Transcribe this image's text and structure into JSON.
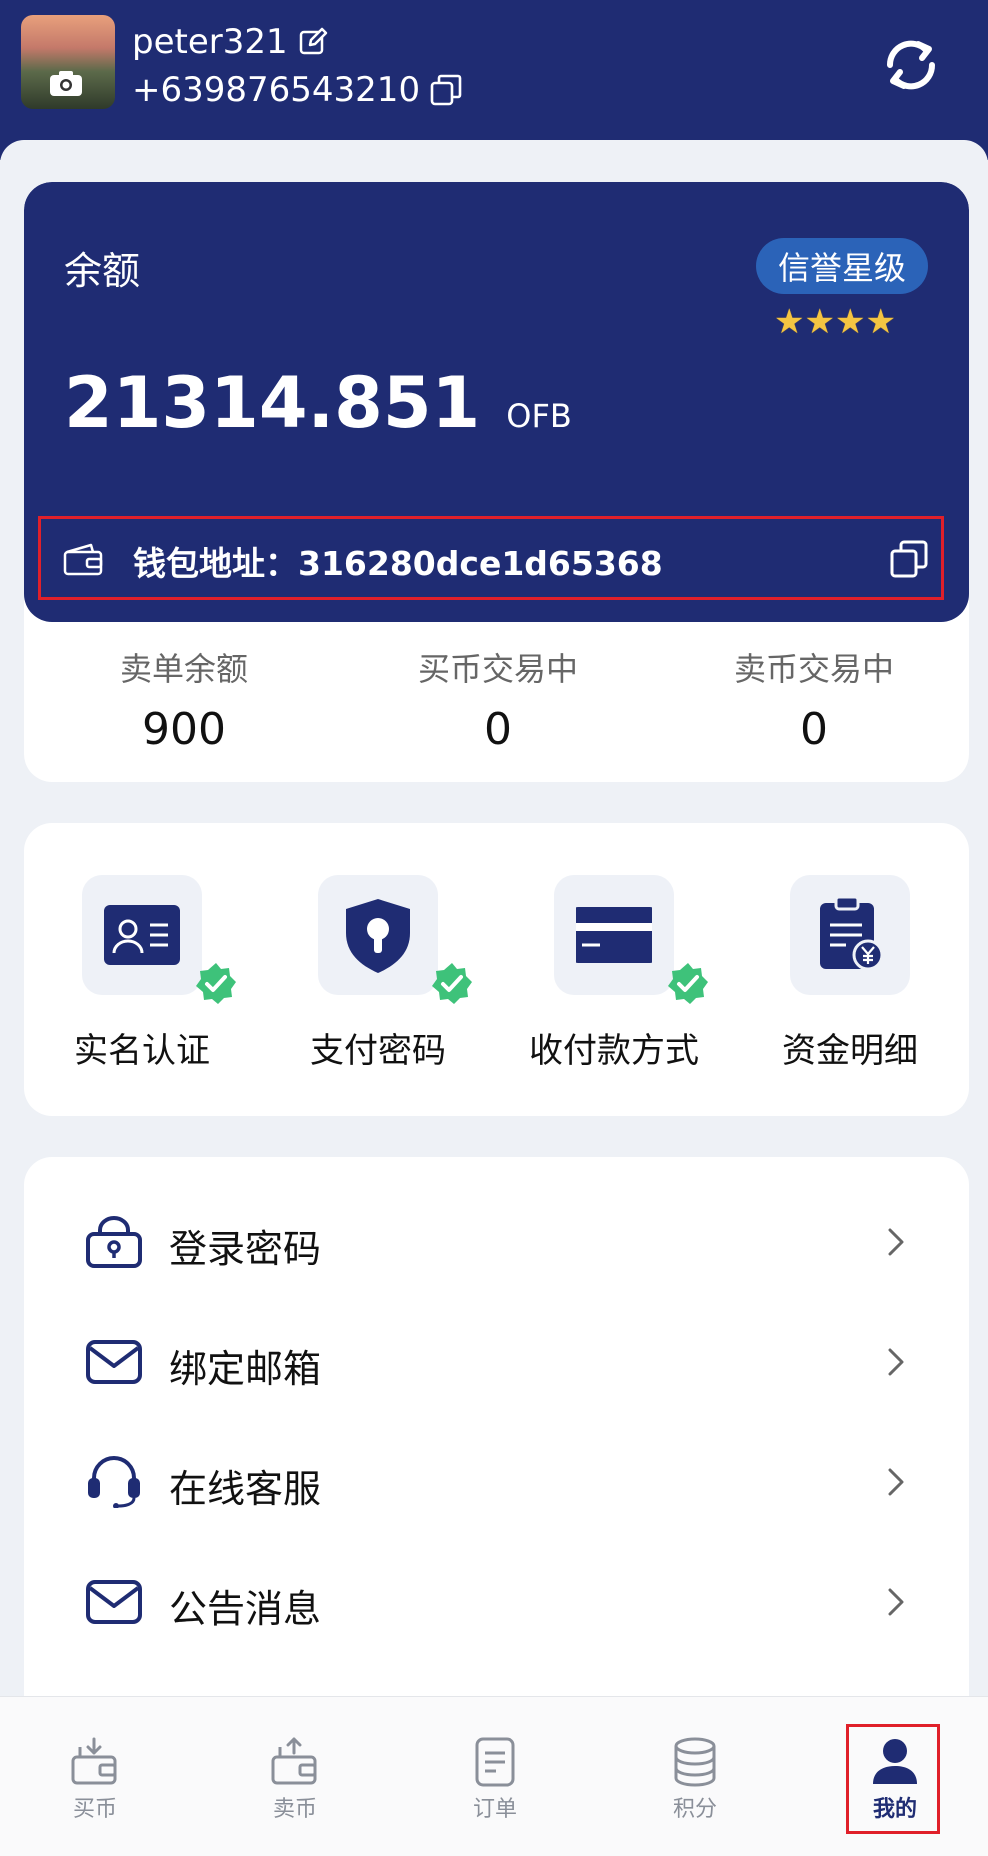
{
  "profile": {
    "username": "peter321",
    "phone": "+639876543210"
  },
  "balance": {
    "label": "余额",
    "credit_badge": "信誉星级",
    "stars": "★★★★",
    "star_count": 4,
    "amount": "21314.851",
    "unit": "OFB",
    "wallet_text": "钱包地址：316280dce1d65368"
  },
  "stats": [
    {
      "label": "卖单余额",
      "value": "900"
    },
    {
      "label": "买币交易中",
      "value": "0"
    },
    {
      "label": "卖币交易中",
      "value": "0"
    }
  ],
  "functions": [
    {
      "label": "实名认证",
      "icon": "id-card-icon",
      "verified": true
    },
    {
      "label": "支付密码",
      "icon": "shield-lock-icon",
      "verified": true
    },
    {
      "label": "收付款方式",
      "icon": "bank-card-icon",
      "verified": true
    },
    {
      "label": "资金明细",
      "icon": "clipboard-yen-icon",
      "verified": false
    }
  ],
  "menu": [
    {
      "label": "登录密码",
      "icon": "padlock-icon"
    },
    {
      "label": "绑定邮箱",
      "icon": "envelope-icon"
    },
    {
      "label": "在线客服",
      "icon": "headset-icon"
    },
    {
      "label": "公告消息",
      "icon": "envelope-icon"
    }
  ],
  "tabs": [
    {
      "label": "买币",
      "icon": "buy-coin-icon"
    },
    {
      "label": "卖币",
      "icon": "sell-coin-icon"
    },
    {
      "label": "订单",
      "icon": "order-list-icon"
    },
    {
      "label": "积分",
      "icon": "coin-stack-icon"
    },
    {
      "label": "我的",
      "icon": "user-icon",
      "active": true
    }
  ],
  "colors": {
    "primary": "#1f2c73",
    "badge": "#2b63b8",
    "verified_green": "#3ec27a",
    "star": "#f4c542",
    "highlight_red": "#e0202a",
    "page_bg": "#eef1f6"
  }
}
